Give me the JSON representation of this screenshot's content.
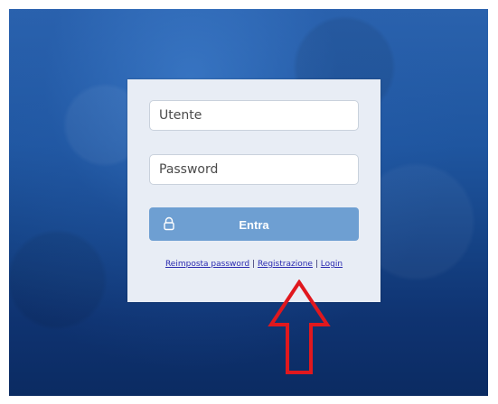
{
  "login": {
    "username_placeholder": "Utente",
    "password_placeholder": "Password",
    "enter_label": "Entra",
    "links": {
      "reset_password": "Reimposta password",
      "separator": "|",
      "register": "Registrazione",
      "login": "Login"
    }
  },
  "icons": {
    "button_icon": "lock-icon",
    "annotation": "red-arrow-up-icon"
  },
  "colors": {
    "button": "#6e9fd2",
    "card": "#e8edf5",
    "arrow": "#e0181e",
    "link": "#2b2bb0"
  }
}
